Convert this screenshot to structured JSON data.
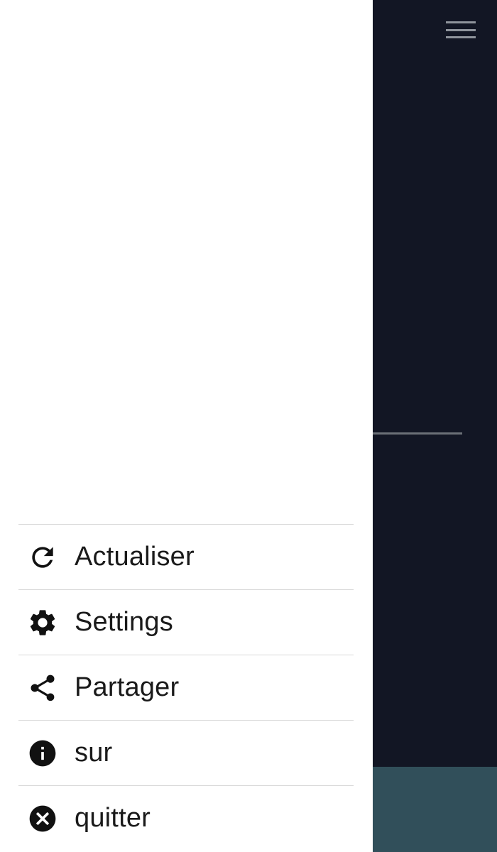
{
  "drawer": {
    "items": [
      {
        "label": "Actualiser",
        "icon": "refresh-icon"
      },
      {
        "label": "Settings",
        "icon": "gear-icon"
      },
      {
        "label": "Partager",
        "icon": "share-icon"
      },
      {
        "label": "sur",
        "icon": "info-icon"
      },
      {
        "label": "quitter",
        "icon": "close-circle-icon"
      }
    ]
  },
  "background": {
    "hamburger_icon": "hamburger-menu-icon",
    "colors": {
      "app_background": "#121624",
      "bottom_bar": "#314f5a",
      "divider": "#6b7077"
    }
  }
}
